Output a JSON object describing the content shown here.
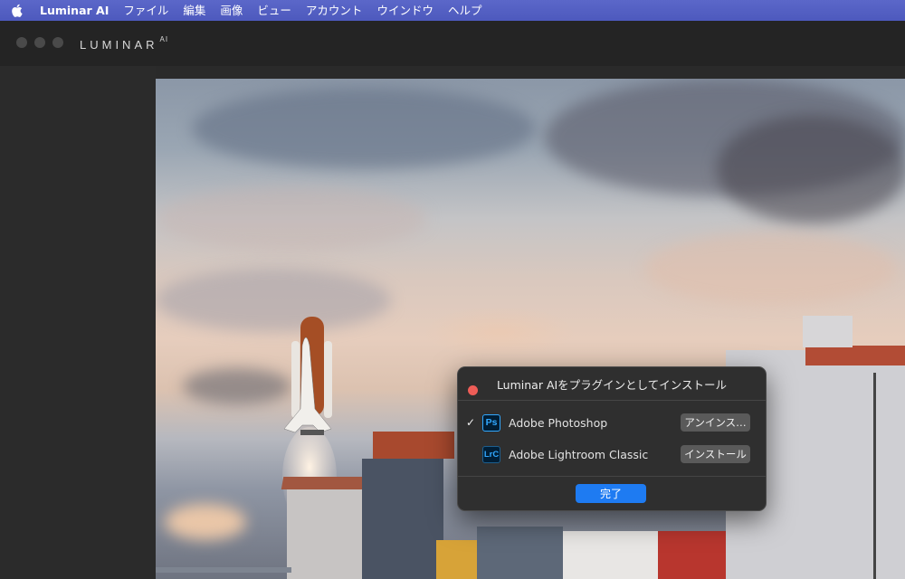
{
  "menubar": {
    "items": [
      "Luminar AI",
      "ファイル",
      "編集",
      "画像",
      "ビュー",
      "アカウント",
      "ウインドウ",
      "ヘルプ"
    ]
  },
  "window": {
    "brand": "LUMINAR",
    "brand_suffix": "AI"
  },
  "dialog": {
    "title": "Luminar AIをプラグインとしてインストール",
    "plugins": [
      {
        "icon_label": "Ps",
        "name": "Adobe Photoshop",
        "installed": true,
        "check": "✓",
        "action": "アンインス…"
      },
      {
        "icon_label": "LrC",
        "name": "Adobe Lightroom Classic",
        "installed": false,
        "check": "",
        "action": "インストール"
      }
    ],
    "done_label": "完了"
  },
  "colors": {
    "menubar": "#4d59bd",
    "accent": "#1e7bf2",
    "close": "#ee5d57"
  },
  "icons": {
    "apple": "apple-logo-icon",
    "close": "close-icon",
    "check": "checkmark-icon"
  }
}
